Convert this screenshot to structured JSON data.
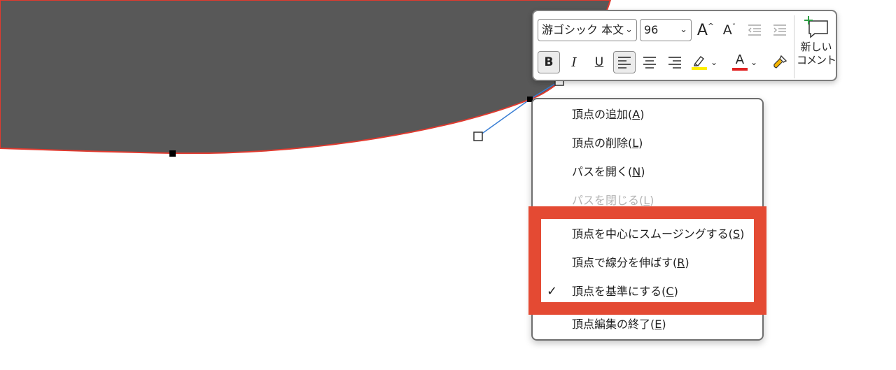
{
  "colors": {
    "shape_fill": "#585858",
    "shape_outline": "#e03a2f",
    "control_line": "#3a7fd5",
    "highlight": "#e44a33",
    "text_highlight_yellow": "#ffee00",
    "font_color_red": "#e02020"
  },
  "toolbar": {
    "font_name": "游ゴシック 本文",
    "font_size": "96",
    "increase_font_icon": "A",
    "decrease_font_icon": "A",
    "bold_label": "B",
    "italic_label": "I",
    "underline_label": "U",
    "font_color_letter": "A",
    "new_comment_line1": "新しい",
    "new_comment_line2": "コメント"
  },
  "context_menu": {
    "items": [
      {
        "text": "頂点の追加(",
        "key": "A",
        "close": ")",
        "enabled": true
      },
      {
        "text": "頂点の削除(",
        "key": "L",
        "close": ")",
        "enabled": true
      },
      {
        "text": "パスを開く(",
        "key": "N",
        "close": ")",
        "enabled": true
      },
      {
        "text": "パスを閉じる(",
        "key": "L",
        "close": ")",
        "enabled": false
      },
      {
        "text": "頂点を中心にスムージングする(",
        "key": "S",
        "close": ")",
        "enabled": true
      },
      {
        "text": "頂点で線分を伸ばす(",
        "key": "R",
        "close": ")",
        "enabled": true
      },
      {
        "text": "頂点を基準にする(",
        "key": "C",
        "close": ")",
        "enabled": true,
        "checked": true
      },
      {
        "text": "頂点編集の終了(",
        "key": "E",
        "close": ")",
        "enabled": true
      }
    ],
    "check_mark": "✓"
  }
}
